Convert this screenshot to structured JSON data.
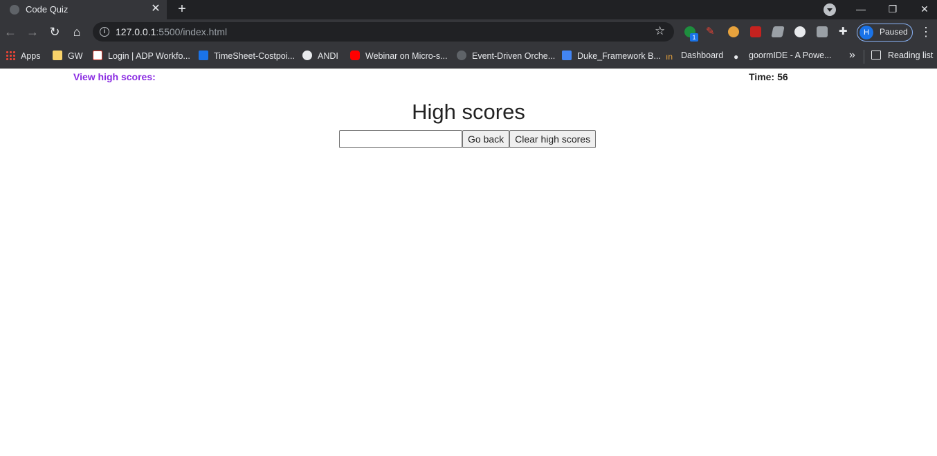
{
  "browser": {
    "tab_title": "Code Quiz",
    "url_host": "127.0.0.1",
    "url_rest": ":5500/index.html",
    "profile_initial": "H",
    "profile_status": "Paused",
    "extension_badge": "1"
  },
  "bookmarks": [
    {
      "label": "Apps"
    },
    {
      "label": "GW"
    },
    {
      "label": "Login | ADP Workfo..."
    },
    {
      "label": "TimeSheet-Costpoi..."
    },
    {
      "label": "ANDI"
    },
    {
      "label": "Webinar on Micro-s..."
    },
    {
      "label": "Event-Driven Orche..."
    },
    {
      "label": "Duke_Framework B..."
    },
    {
      "label": "Dashboard"
    },
    {
      "label": "goormIDE - A Powe..."
    }
  ],
  "reading_list": "Reading list",
  "page": {
    "view_high_scores": "View high scores:",
    "time_label": "Time:",
    "time_value": "56",
    "heading": "High scores",
    "input_value": "",
    "go_back": "Go back",
    "clear_scores": "Clear high scores"
  }
}
